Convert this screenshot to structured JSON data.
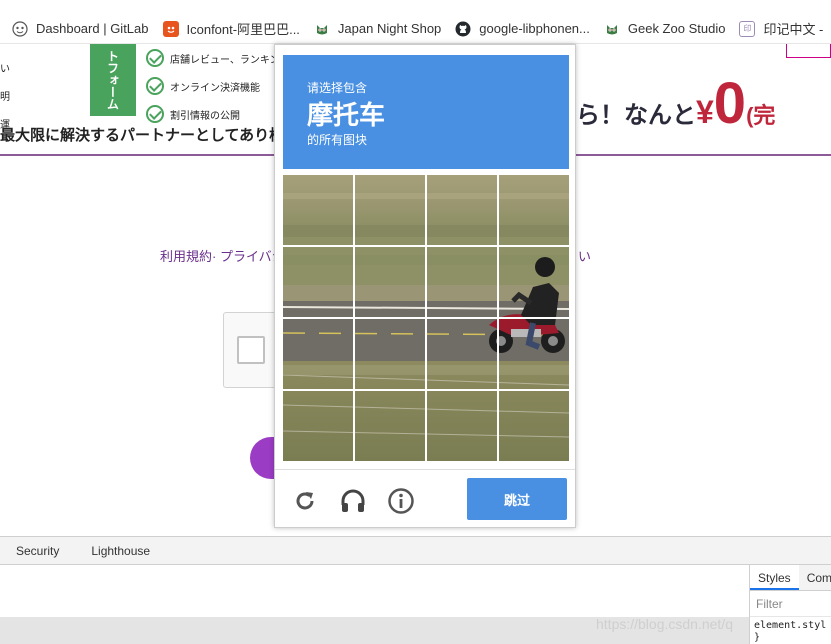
{
  "bookmarks": [
    {
      "label": "Dashboard | GitLab",
      "icon": "gitlab-fox-icon",
      "color": "#e24329"
    },
    {
      "label": "Iconfont-阿里巴巴...",
      "icon": "iconfont-icon",
      "color": "#e8541e"
    },
    {
      "label": "Japan Night Shop",
      "icon": "owl-icon",
      "color": "#3a7d44"
    },
    {
      "label": "google-libphonen...",
      "icon": "github-icon",
      "color": "#24292e"
    },
    {
      "label": "Geek Zoo Studio",
      "icon": "owl-icon",
      "color": "#3a7d44"
    },
    {
      "label": "印记中文 -",
      "icon": "yinji-icon",
      "color": "#9e8bb5"
    }
  ],
  "banner": {
    "left_lines": [
      "い",
      "明",
      "運"
    ],
    "green_label": "トフォーム",
    "features": [
      "店舗レビュー、ランキング機",
      "オンライン決済機能",
      "割引情報の公開"
    ],
    "bottom_text": "最大限に解決するパートナーとしてあり様",
    "right_text": "ら！なんと",
    "yen": "¥",
    "zero": "0",
    "right_tail": "(完"
  },
  "terms": {
    "text": "利用規約· プライバシ",
    "tail": "い"
  },
  "challenge": {
    "line1": "请选择包含",
    "target": "摩托车",
    "line3": "的所有图块",
    "header_color": "#4a90e2",
    "verify_label": "跳过",
    "icons": [
      "reload-icon",
      "headphones-icon",
      "info-icon"
    ]
  },
  "devtools": {
    "tabs": [
      "Security",
      "Lighthouse"
    ],
    "side_tabs": [
      "Styles",
      "Com"
    ],
    "filter_placeholder": "Filter",
    "code_line1": "element.styl",
    "code_line2": "}"
  },
  "watermark": "https://blog.csdn.net/q"
}
